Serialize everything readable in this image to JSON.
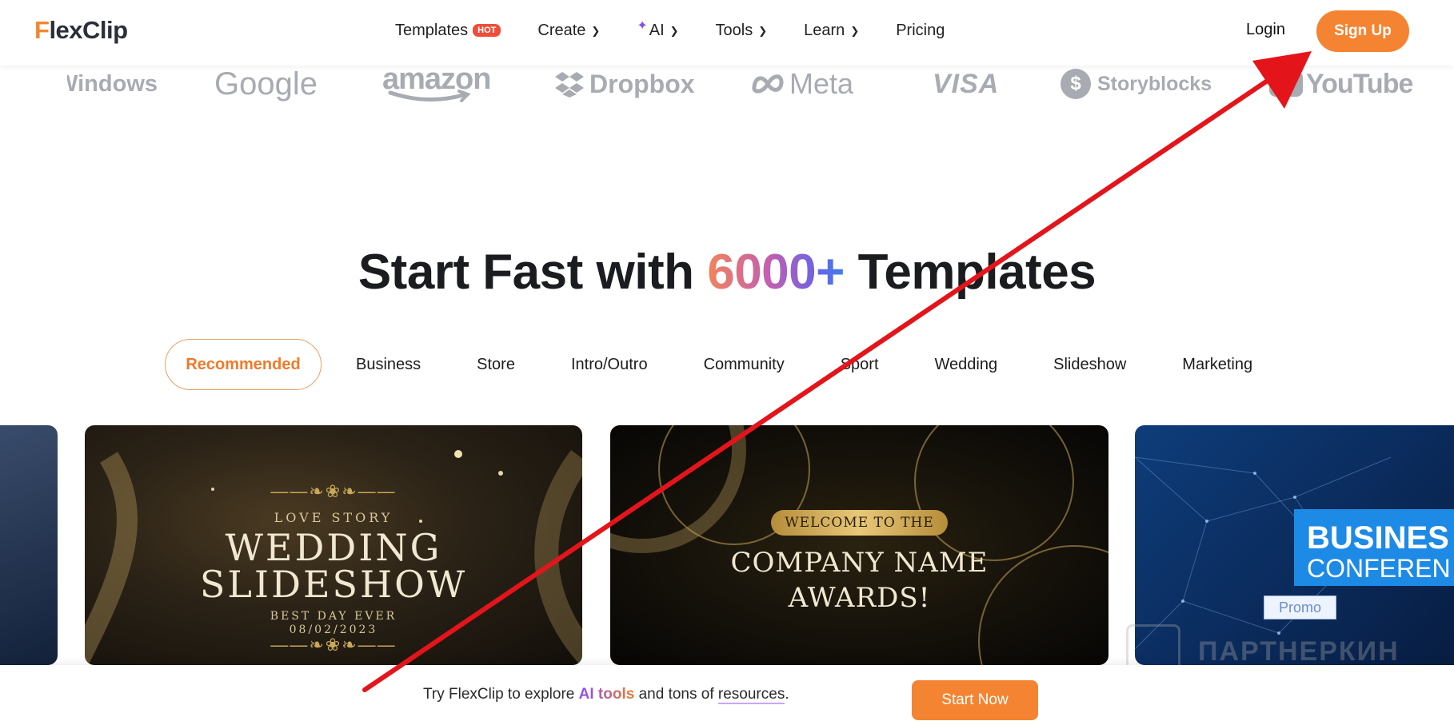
{
  "header": {
    "logo_f": "F",
    "logo_rest": "lexClip",
    "nav": [
      {
        "label": "Templates",
        "badge": "HOT"
      },
      {
        "label": "Create"
      },
      {
        "label": "AI"
      },
      {
        "label": "Tools"
      },
      {
        "label": "Learn"
      },
      {
        "label": "Pricing"
      }
    ],
    "login": "Login",
    "signup": "Sign Up"
  },
  "brands": {
    "windows": "Windows",
    "google": "Google",
    "amazon": "amazon",
    "dropbox": "Dropbox",
    "meta": "Meta",
    "visa": "VISA",
    "storyblocks": "Storyblocks",
    "youtube": "YouTube"
  },
  "headline": {
    "prefix": "Start Fast with ",
    "highlight": "6000+",
    "suffix": " Templates"
  },
  "tabs": [
    "Recommended",
    "Business",
    "Store",
    "Intro/Outro",
    "Community",
    "Sport",
    "Wedding",
    "Slideshow",
    "Marketing"
  ],
  "cards": {
    "wedding": {
      "kicker": "LOVE STORY",
      "title1": "WEDDING",
      "title2": "SLIDESHOW",
      "sub": "BEST DAY EVER",
      "date": "08/02/2023"
    },
    "awards": {
      "pill": "WELCOME TO THE",
      "title1": "COMPANY NAME",
      "title2": "AWARDS!"
    },
    "business": {
      "title1": "BUSINES",
      "title2": "CONFEREN",
      "promo": "Promo"
    }
  },
  "watermark": "ПАРТНЕРКИН",
  "bottom_bar": {
    "text_prefix": "Try FlexClip to explore ",
    "ai_link": "AI tools",
    "text_mid": " and tons of ",
    "resources_link": "resources",
    "text_suffix": ".",
    "button": "Start Now"
  },
  "colors": {
    "brand_orange": "#f48431",
    "annotation_red": "#e3151b"
  }
}
